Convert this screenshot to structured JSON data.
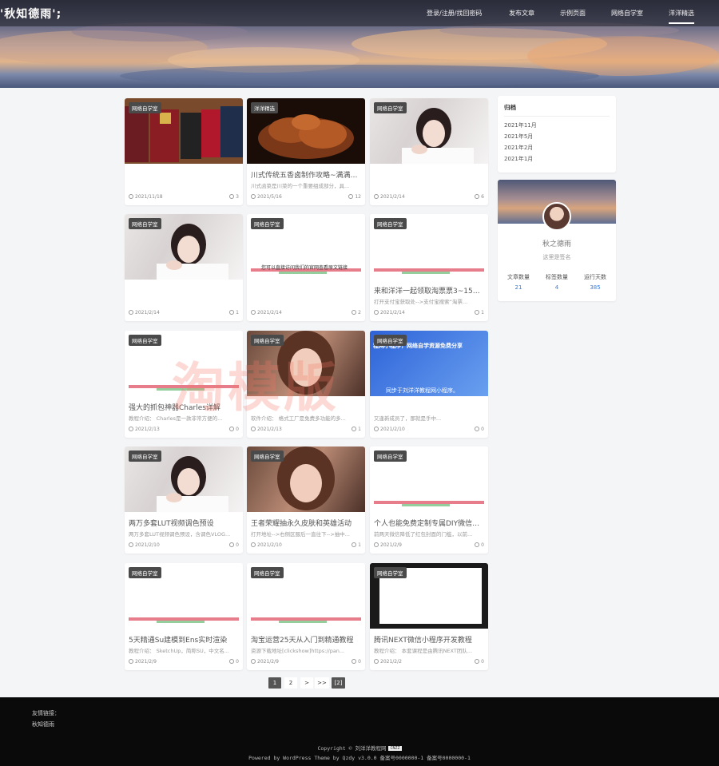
{
  "site": {
    "title": "'秋知德雨';",
    "nav": [
      "登录/注册/找回密码",
      "发布文章",
      "示例页面",
      "网络自学室",
      "洋洋精选"
    ]
  },
  "cards": [
    {
      "tag": "网络自学室",
      "title": "",
      "desc": "",
      "date": "2021/11/18",
      "count": "3",
      "thumb": "books"
    },
    {
      "tag": "洋洋精选",
      "title": "川式传统五香卤制作攻略~满满干货...",
      "desc": "川式卤菜是川菜的一个重要组成部分，具...",
      "date": "2021/5/16",
      "count": "12",
      "thumb": "food"
    },
    {
      "tag": "网络自学室",
      "title": "",
      "desc": "",
      "date": "2021/2/14",
      "count": "6",
      "thumb": "girl"
    },
    {
      "tag": "网络自学室",
      "title": "",
      "desc": "",
      "date": "2021/2/14",
      "count": "1",
      "thumb": "girl"
    },
    {
      "tag": "网络自学室",
      "title": "",
      "desc": "",
      "date": "2021/2/14",
      "count": "2",
      "thumb": "white",
      "thumb_text": "您可以直接访问我们的官网查看原文链接"
    },
    {
      "tag": "网络自学室",
      "title": "来和洋洋一起领取淘票票3~15元...",
      "desc": "打开支付宝获取处-->支付宝搜索“淘票...",
      "date": "2021/2/14",
      "count": "1",
      "thumb": "white"
    },
    {
      "tag": "网络自学室",
      "title": "强大的抓包神器Charles详解",
      "desc": "教程介绍： Charles是一款非常方便的...",
      "date": "2021/2/13",
      "count": "0",
      "thumb": "white"
    },
    {
      "tag": "网络自学室",
      "title": "",
      "desc": "软件介绍： 格式工厂是免费多功能的多...",
      "date": "2021/2/13",
      "count": "1",
      "thumb": "girl2"
    },
    {
      "tag": "网络自学室",
      "title": "",
      "desc": "又逢新成员了，那就是手中...",
      "date": "2021/2/10",
      "count": "0",
      "thumb": "blue",
      "thumb_text": "同步于刘洋洋教程网小程序。",
      "thumb_text2": "程网小程序，网络自学资源免费分享"
    },
    {
      "tag": "网络自学室",
      "title": "两万多套LUT视频调色预设",
      "desc": "两万多套LUT视频调色预设，含调色VLOG...",
      "date": "2021/2/10",
      "count": "0",
      "thumb": "girl"
    },
    {
      "tag": "网络自学室",
      "title": "王者荣耀抽永久皮肤和英雄活动",
      "desc": "打开地址-->右侧区服后一直往下-->抽中...",
      "date": "2021/2/10",
      "count": "1",
      "thumb": "girl2"
    },
    {
      "tag": "网络自学室",
      "title": "个人也能免费定制专属DIY微信红...",
      "desc": "前两天微信降低了红包封面的门槛，以前...",
      "date": "2021/2/9",
      "count": "0",
      "thumb": "white"
    },
    {
      "tag": "网络自学室",
      "title": "5天精通Su建模到Ens实时渲染",
      "desc": "教程介绍： SketchUp，简称SU，中文名...",
      "date": "2021/2/9",
      "count": "0",
      "thumb": "white"
    },
    {
      "tag": "网络自学室",
      "title": "淘宝运营25天从入门到精通教程",
      "desc": "资源下载地址[clickshow]https://pan...",
      "date": "2021/2/9",
      "count": "0",
      "thumb": "white"
    },
    {
      "tag": "网络自学室",
      "title": "腾讯NEXT微信小程序开发教程",
      "desc": "教程介绍： 本套课程是由腾讯NEXT团队...",
      "date": "2021/2/2",
      "count": "0",
      "thumb": "black"
    }
  ],
  "sidebar": {
    "archive_title": "归档",
    "archive": [
      "2021年11月",
      "2021年5月",
      "2021年2月",
      "2021年1月"
    ],
    "profile": {
      "name": "秋之德雨",
      "signature": "这里是签名",
      "stats": [
        {
          "label": "文章数量",
          "value": "21"
        },
        {
          "label": "标签数量",
          "value": "4"
        },
        {
          "label": "运行天数",
          "value": "385"
        }
      ]
    }
  },
  "pagination": [
    "1",
    "2",
    ">",
    ">>",
    "[2]"
  ],
  "watermark": "淘模版",
  "footer": {
    "links_label": "友情链接：",
    "link": "秋知德雨",
    "copyright": "Copyright © 刘洋洋教程网",
    "badge": "CNZZ",
    "powered": "Powered by WordPress Theme by Qzdy v3.0.0 备案号0000000-1 备案号0000000-1"
  },
  "colors": {
    "accent": "#3a7bd5",
    "footer_bg": "#0a0a0a",
    "tag_bg": "#4a4a4a"
  }
}
